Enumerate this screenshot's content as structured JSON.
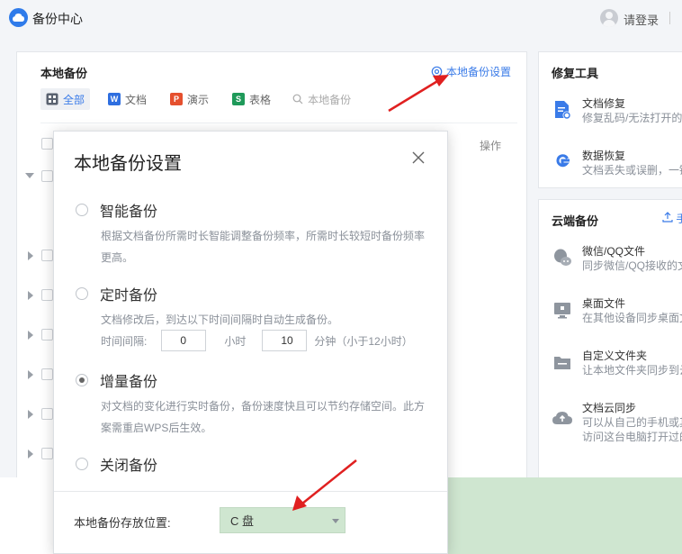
{
  "app": {
    "title": "备份中心",
    "login_label": "请登录"
  },
  "local_backup": {
    "title": "本地备份",
    "settings_link": "本地备份设置",
    "tabs": [
      {
        "label": "全部",
        "icon": "grid-icon"
      },
      {
        "label": "文档",
        "icon": "W",
        "color": "#2f6fe0"
      },
      {
        "label": "演示",
        "icon": "P",
        "color": "#e5502e"
      },
      {
        "label": "表格",
        "icon": "S",
        "color": "#1f9a5a"
      }
    ],
    "search_placeholder": "本地备份",
    "action_header": "操作"
  },
  "repair_tools": {
    "title": "修复工具",
    "items": [
      {
        "name": "文档修复",
        "desc": "修复乱码/无法打开的",
        "icon": "document-repair-icon"
      },
      {
        "name": "数据恢复",
        "desc": "文档丢失或误删，一键",
        "icon": "data-recovery-icon"
      }
    ]
  },
  "cloud_backup": {
    "title": "云端备份",
    "upload_label": "手",
    "items": [
      {
        "name": "微信/QQ文件",
        "desc": "同步微信/QQ接收的文",
        "icon": "wechat-qq-icon"
      },
      {
        "name": "桌面文件",
        "desc": "在其他设备同步桌面文",
        "icon": "desktop-icon"
      },
      {
        "name": "自定义文件夹",
        "desc": "让本地文件夹同步到云",
        "icon": "folder-icon"
      },
      {
        "name": "文档云同步",
        "desc": "可以从自己的手机或其",
        "desc2": "访问这台电脑打开过的",
        "icon": "cloud-upload-icon"
      }
    ]
  },
  "dialog": {
    "title": "本地备份设置",
    "options": [
      {
        "label": "智能备份",
        "desc": "根据文档备份所需时长智能调整备份频率，所需时长较短时备份频率更高。",
        "checked": false
      },
      {
        "label": "定时备份",
        "desc": "文档修改后，到达以下时间间隔时自动生成备份。",
        "checked": false
      },
      {
        "label": "增量备份",
        "desc": "对文档的变化进行实时备份，备份速度快且可以节约存储空间。此方案需重启WPS后生效。",
        "checked": true
      },
      {
        "label": "关闭备份",
        "checked": false
      }
    ],
    "interval": {
      "label": "时间间隔:",
      "hours_value": "0",
      "hours_unit": "小时",
      "minutes_value": "10",
      "minutes_unit": "分钟（小于12小时）"
    },
    "location_label": "本地备份存放位置:",
    "location_value": "C 盘"
  },
  "colors": {
    "accent": "#3a7be8",
    "annotation_arrow": "#e02020",
    "selected_drive_bg": "#cfe6d0"
  }
}
